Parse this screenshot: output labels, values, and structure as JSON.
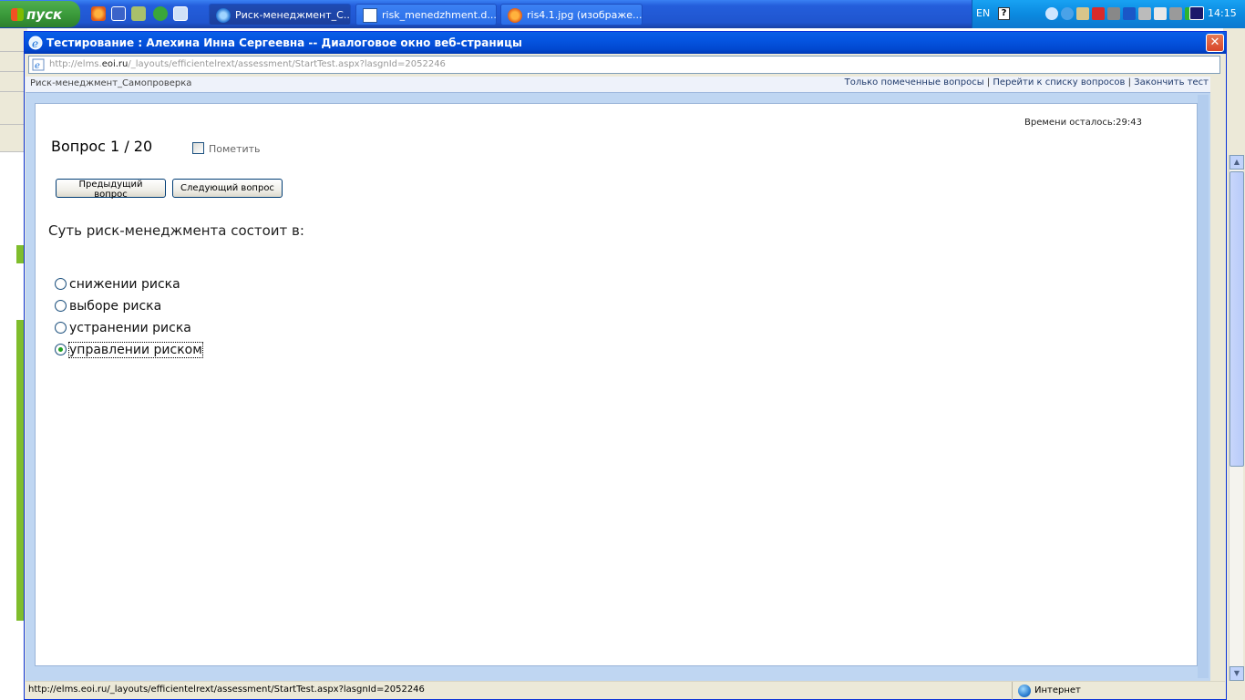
{
  "taskbar": {
    "start_label": "пуск",
    "tasks": [
      {
        "label": "Риск-менеджмент_С...",
        "icon": "ie-icon",
        "active": true
      },
      {
        "label": "risk_menedzhment.d...",
        "icon": "document-icon",
        "active": false
      },
      {
        "label": "ris4.1.jpg (изображе...",
        "icon": "firefox-icon",
        "active": false
      }
    ],
    "language": "EN",
    "help_glyph": "?",
    "clock": "14:15"
  },
  "dialog": {
    "title": "Тестирование : Алехина Инна Сергеевна -- Диалоговое окно веб-страницы",
    "close_glyph": "✕",
    "address_prefix": "http://elms.",
    "address_domain": "eoi.ru",
    "address_rest": "/_layouts/efficientelrext/assessment/StartTest.aspx?lasgnId=2052246"
  },
  "header": {
    "course_name": "Риск-менеджмент_Самопроверка",
    "links": {
      "marked_only": "Только помеченные вопросы",
      "question_list": "Перейти к списку вопросов",
      "finish": "Закончить тест",
      "separator": " | "
    }
  },
  "test": {
    "time_left": "Времени осталось:29:43",
    "question_number": "Вопрос 1 / 20",
    "mark_label": "Пометить",
    "prev_button": "Предыдущий вопрос",
    "next_button": "Следующий вопрос",
    "question_text": "Суть риск-менеджмента состоит в:",
    "options": [
      {
        "label": "снижении риска",
        "selected": false
      },
      {
        "label": "выборе риска",
        "selected": false
      },
      {
        "label": "устранении риска",
        "selected": false
      },
      {
        "label": "управлении риском",
        "selected": true
      }
    ]
  },
  "status": {
    "url": "http://elms.eoi.ru/_layouts/efficientelrext/assessment/StartTest.aspx?lasgnId=2052246",
    "zone": "Интернет"
  },
  "colors": {
    "titlebar": "#0554e0",
    "taskbar": "#245edb",
    "selected_radio": "#21a121",
    "frame": "#bfd6f2"
  }
}
